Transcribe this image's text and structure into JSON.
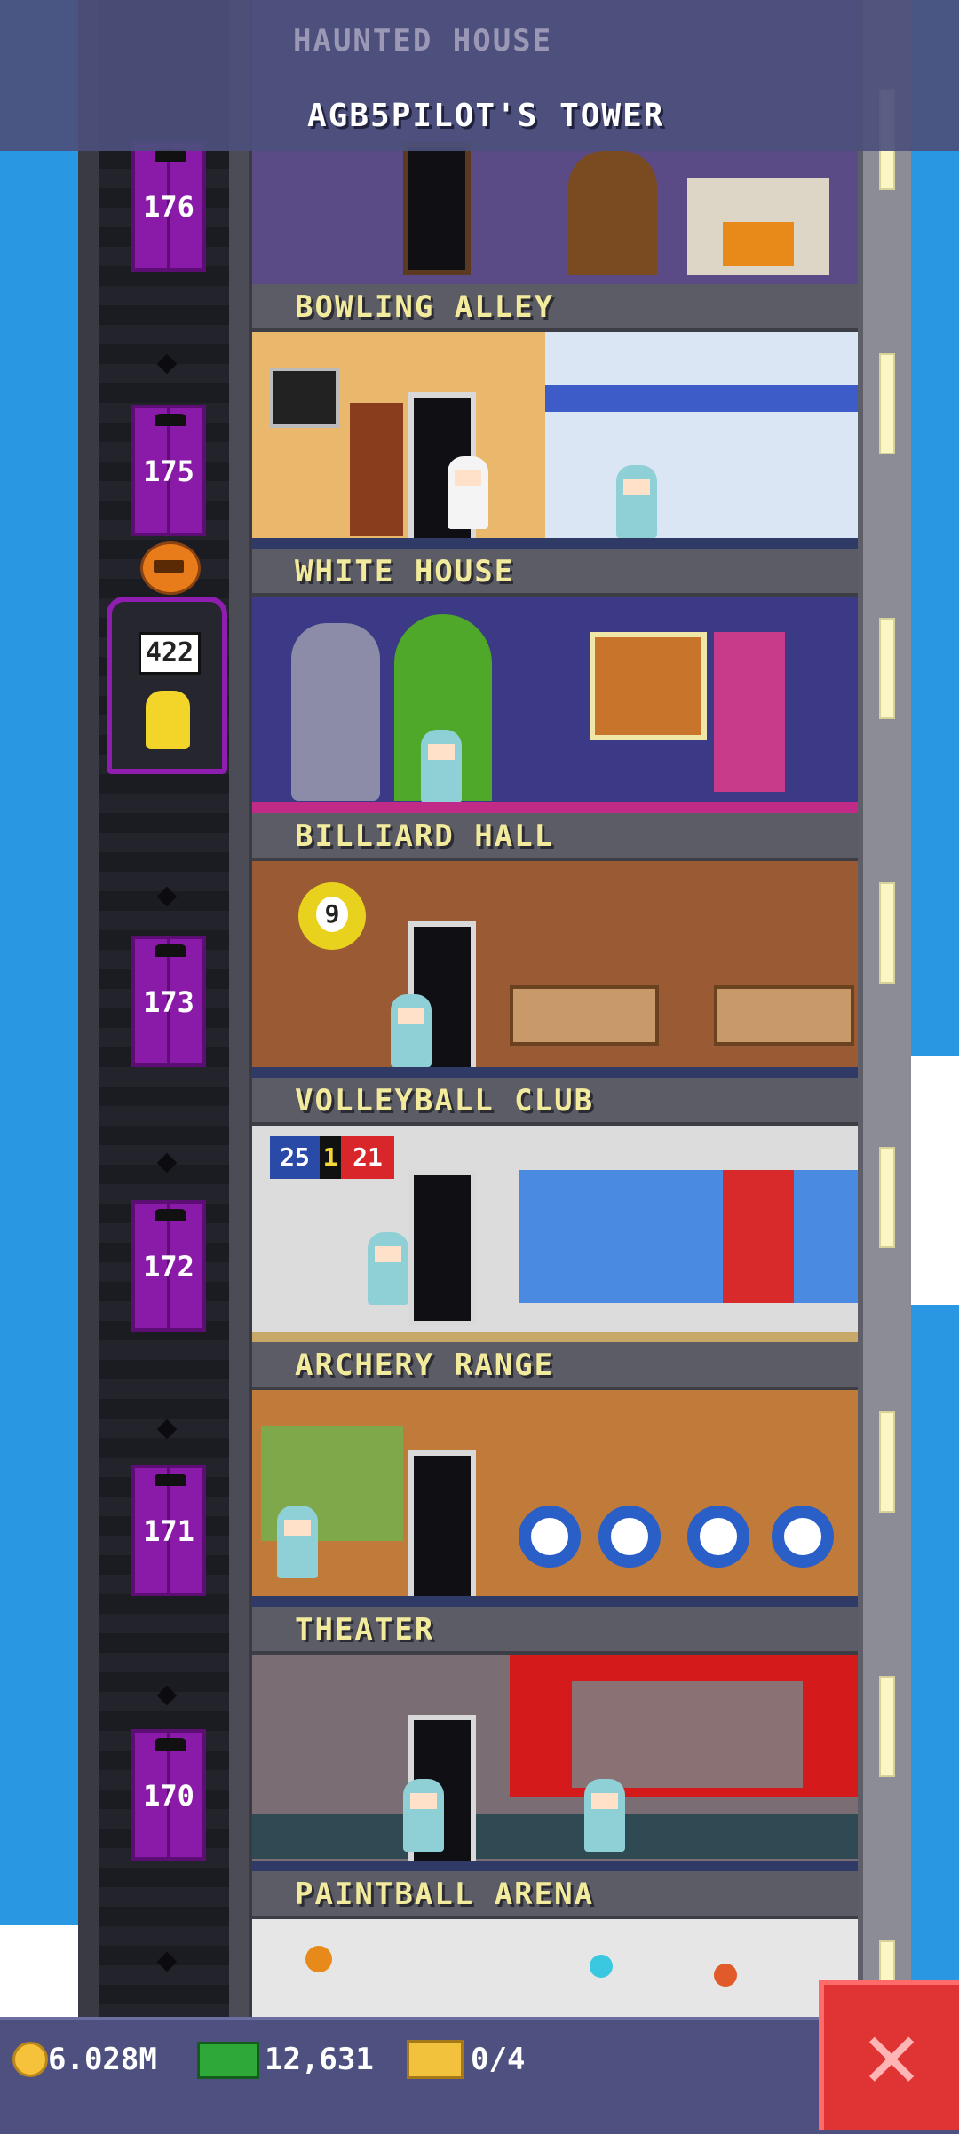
{
  "header": {
    "partial_floor_label": "HAUNTED HOUSE",
    "tower_title": "AGB5PILOT'S TOWER"
  },
  "floors": [
    {
      "name": "BOWLING ALLEY"
    },
    {
      "name": "WHITE HOUSE"
    },
    {
      "name": "BILLIARD HALL"
    },
    {
      "name": "VOLLEYBALL CLUB"
    },
    {
      "name": "ARCHERY RANGE"
    },
    {
      "name": "THEATER"
    },
    {
      "name": "PAINTBALL ARENA"
    }
  ],
  "elevator": {
    "floor_numbers": [
      "176",
      "175",
      "173",
      "172",
      "171",
      "170"
    ],
    "car_display": "422"
  },
  "scoreboard": {
    "left": "25",
    "mid": "1",
    "right": "21"
  },
  "billiard_ball": "9",
  "status": {
    "coins": "6.028M",
    "bux": "12,631",
    "tickets": "0/4"
  },
  "colors": {
    "sky": "#2a97e3",
    "elevator_door": "#8a1aa8",
    "label_text": "#f2ea9c",
    "close_button": "#e03434"
  },
  "icons": {
    "coin": "coin-icon",
    "bux": "tower-bux-icon",
    "ticket": "golden-ticket-icon",
    "close": "close-icon",
    "pumpkin": "pumpkin-icon"
  }
}
